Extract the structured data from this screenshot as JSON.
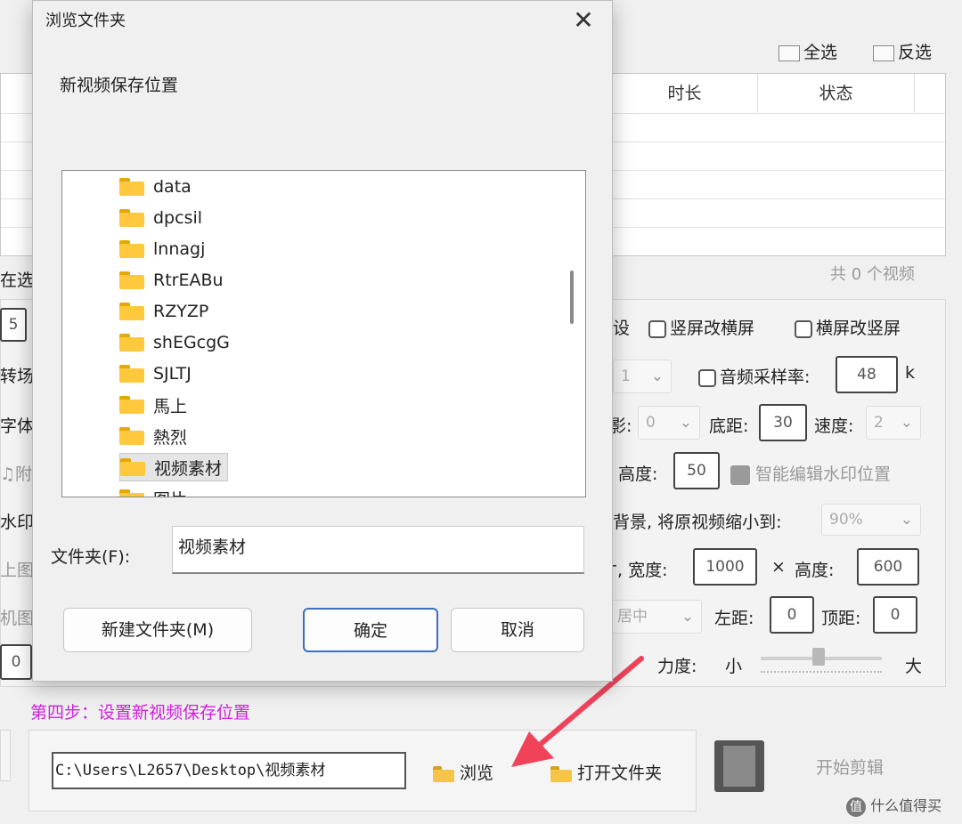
{
  "app": {
    "select_all": "全选",
    "invert_select": "反选",
    "table_headers": {
      "duration": "时长",
      "status": "状态"
    },
    "video_count": "共 0 个视频",
    "clip_left_1": "在选",
    "clip_left_2": "转场",
    "clip_left_3": "字体:",
    "clip_left_4": "附",
    "clip_left_5": "水印",
    "clip_left_6": "上图",
    "clip_left_7": "机图",
    "clip_left_6_value": "0",
    "clip_left_1_value": "5",
    "clip_setting_1": "设",
    "portrait_to_landscape": "竖屏改横屏",
    "landscape_to_portrait": "横屏改竖屏",
    "combo_1_value": "1",
    "audio_sample_rate": "音频采样率:",
    "audio_sample_value": "48",
    "audio_unit": "k",
    "shadow_frag": "影:",
    "shadow_value": "0",
    "bottom_margin": "底距:",
    "bottom_margin_value": "30",
    "speed": "速度:",
    "speed_value": "2",
    "height_label": "高度:",
    "height_value": "50",
    "smart_watermark": "智能编辑水印位置",
    "background_text": "背景, 将原视频缩小到:",
    "scale_value": "90%",
    "width_label_frag": "寸, 宽度:",
    "width_value": "1000",
    "times": "×",
    "height2_label": "高度:",
    "height2_value": "600",
    "align_value": "居中",
    "left_margin": "左距:",
    "left_margin_value": "0",
    "top_margin": "顶距:",
    "top_margin_value": "0",
    "strength": "力度:",
    "strength_small": "小",
    "strength_large": "大",
    "step4": "第四步：设置新视频保存位置",
    "save_path": "C:\\Users\\L2657\\Desktop\\视频素材",
    "browse": "浏览",
    "open_folder": "打开文件夹",
    "start_edit": "开始剪辑",
    "watermark_site": "什么值得买"
  },
  "dialog": {
    "title": "浏览文件夹",
    "close_glyph": "✕",
    "description": "新视频保存位置",
    "folders": [
      "data",
      "dpcsil",
      "lnnagj",
      "RtrEABu",
      "RZYZP",
      "shEGcgG",
      "SJLTJ",
      "馬上",
      "熱烈",
      "视频素材",
      "图片"
    ],
    "selected_folder_index": 9,
    "folder_label": "文件夹(F):",
    "folder_value": "视频素材",
    "new_folder": "新建文件夹(M)",
    "ok": "确定",
    "cancel": "取消"
  },
  "colors": {
    "step_text": "#d21fe0",
    "annotation_arrow": "#f0435a",
    "folder_yellow": "#ffc83d",
    "primary_button_border": "#3a6fc4"
  }
}
